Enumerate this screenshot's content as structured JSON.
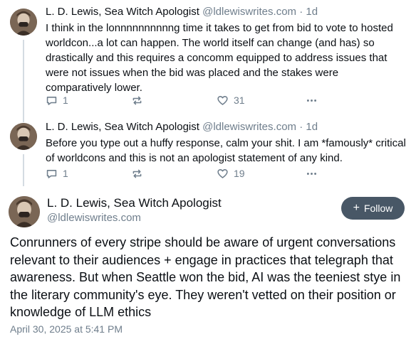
{
  "thread": [
    {
      "display_name": "L. D. Lewis, Sea Witch Apologist",
      "handle": "@ldlewiswrites.com",
      "separator": "·",
      "time": "1d",
      "text": "I think in the lonnnnnnnnnng time it takes to get from bid to vote to hosted worldcon...a lot can happen. The world itself can change (and has) so drastically and this requires a concomm equipped to address issues that were not issues when the bid was placed and the stakes were comparatively lower.",
      "reply_count": "1",
      "like_count": "31"
    },
    {
      "display_name": "L. D. Lewis, Sea Witch Apologist",
      "handle": "@ldlewiswrites.com",
      "separator": "·",
      "time": "1d",
      "text": "Before you type out a huffy response, calm your shit. I am *famously* critical of worldcons and this is not an apologist statement of any kind.",
      "reply_count": "1",
      "like_count": "19"
    }
  ],
  "main_post": {
    "display_name": "L. D. Lewis, Sea Witch Apologist",
    "handle": "@ldlewiswrites.com",
    "follow_label": "Follow",
    "follow_icon": "+",
    "text": "Conrunners of every stripe should be aware of urgent conversations relevant to their audiences + engage in practices that telegraph that awareness. But when Seattle won the bid, AI was the teeniest stye in the literary community's eye. They weren't vetted on their position or knowledge of LLM ethics",
    "timestamp": "April 30, 2025 at 5:41 PM"
  },
  "icons": {
    "reply": "speech-bubble-icon",
    "repost": "repost-arrows-icon",
    "like": "heart-icon",
    "more": "ellipsis-icon"
  },
  "colors": {
    "text": "#0b0f14",
    "muted": "#6f7e8c",
    "follow_bg": "#485766",
    "thread_line": "#d4dbe2"
  }
}
